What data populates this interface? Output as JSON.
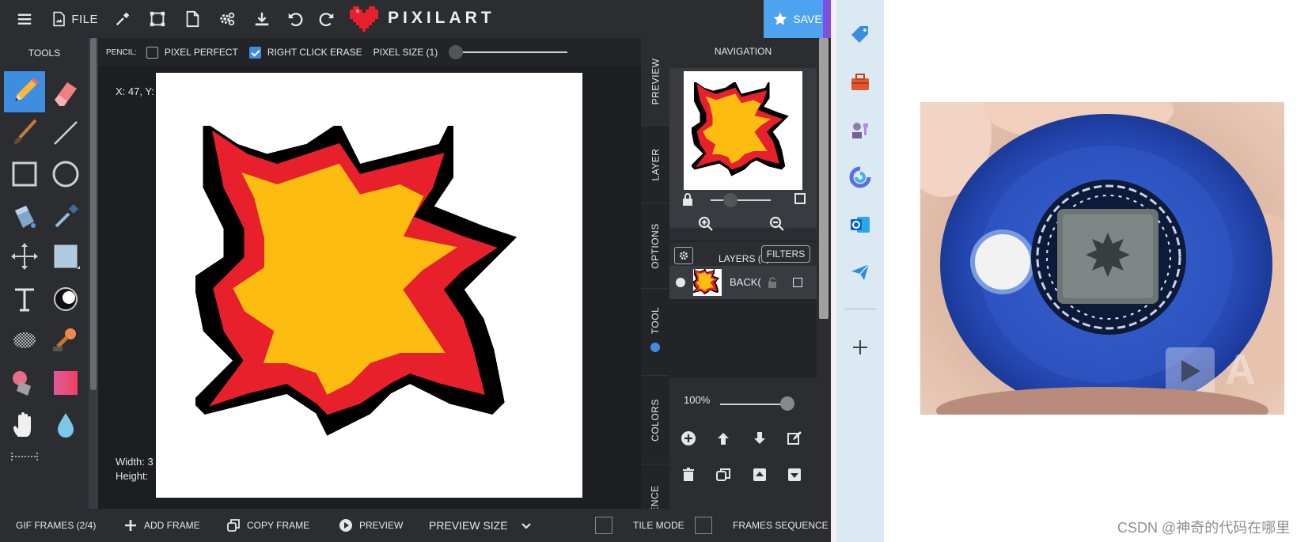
{
  "app": {
    "logo_text": "PIXILART",
    "file_label": "FILE",
    "save_label": "SAVE"
  },
  "tools": {
    "title": "TOOLS"
  },
  "options": {
    "tool_label": "PENCIL:",
    "pixel_perfect_label": "PIXEL PERFECT",
    "pixel_perfect_checked": false,
    "right_click_erase_label": "RIGHT CLICK ERASE",
    "right_click_erase_checked": true,
    "pixel_size_label": "PIXEL SIZE (1)"
  },
  "canvas": {
    "coords": "X: 47, Y:",
    "width_label": "Width: 3",
    "height_label": "Height:",
    "colors": {
      "black": "#000000",
      "red": "#e8202c",
      "yellow": "#fdbd10",
      "white": "#ffffff"
    }
  },
  "side_tabs": [
    "PREVIEW",
    "LAYER",
    "OPTIONS",
    "TOOL",
    "COLORS",
    "ENCE"
  ],
  "navigation": {
    "title": "NAVIGATION"
  },
  "layers": {
    "title": "LAYERS (1)",
    "filters_label": "FILTERS",
    "layer_name": "BACK(",
    "opacity": "100%"
  },
  "bottom": {
    "gif_frames": "GIF FRAMES (2/4)",
    "add_frame": "ADD FRAME",
    "copy_frame": "COPY FRAME",
    "preview": "PREVIEW",
    "preview_size": "PREVIEW SIZE",
    "tile_mode": "TILE MODE",
    "frames_sequence": "FRAMES SEQUENCE"
  },
  "watermark": "CSDN @神奇的代码在哪里"
}
